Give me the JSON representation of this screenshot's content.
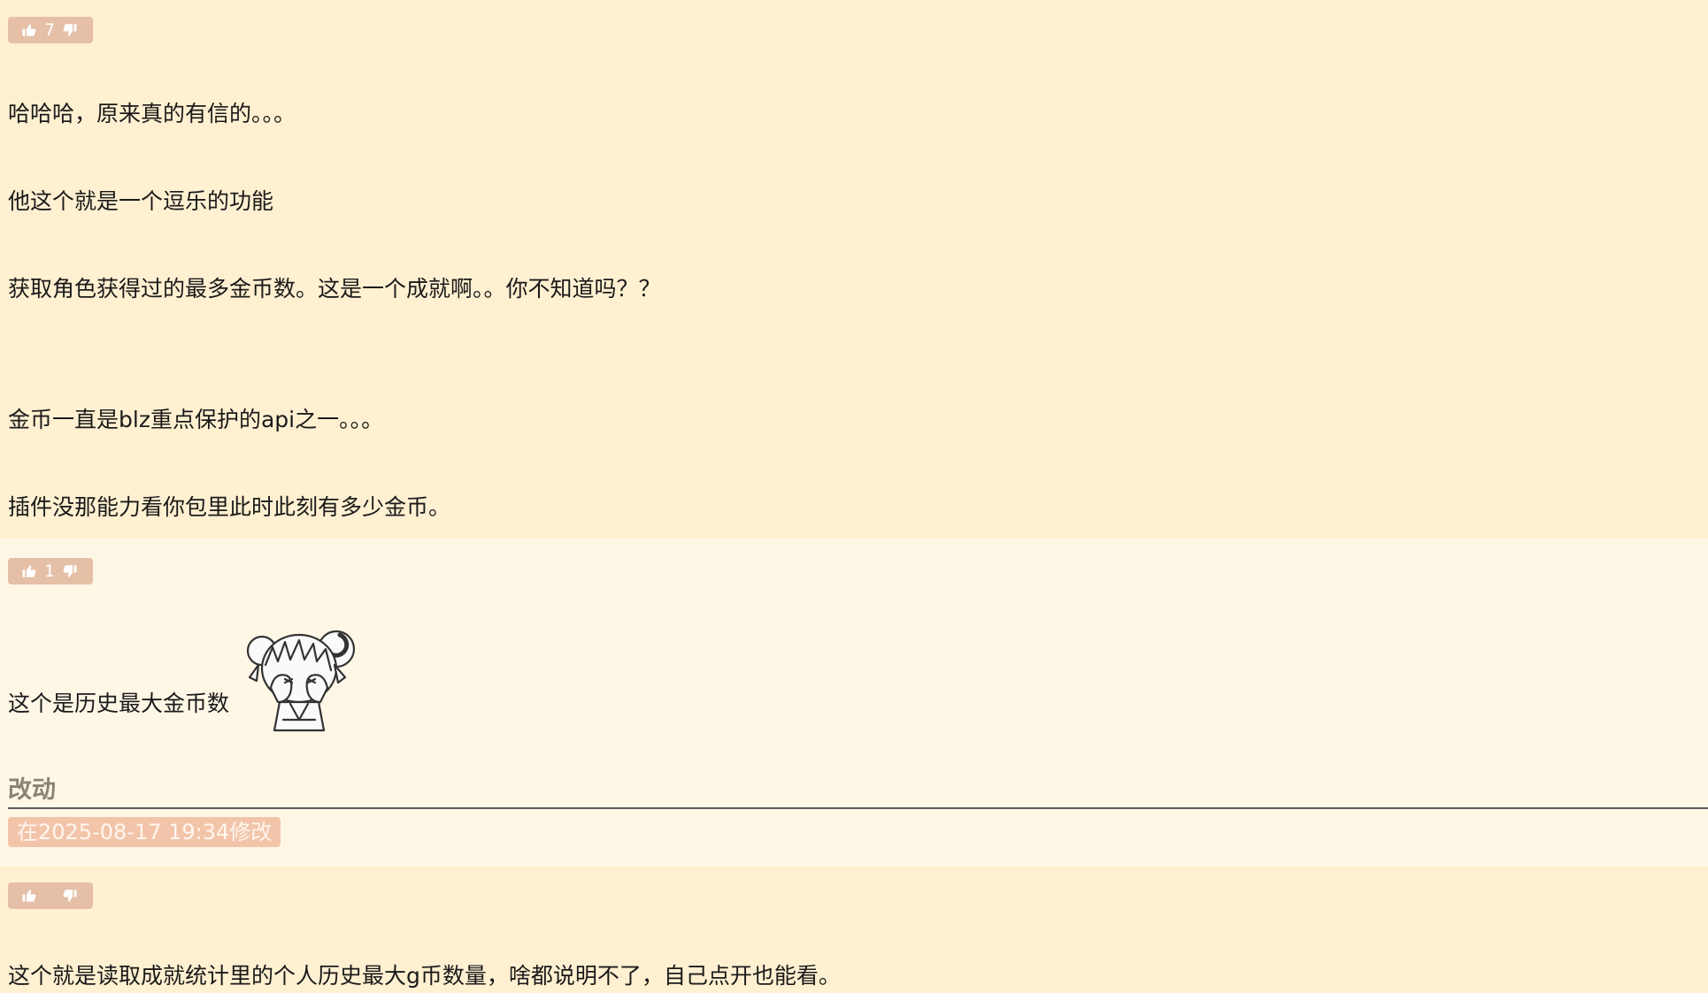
{
  "posts": [
    {
      "votes": {
        "count": "7"
      },
      "lines": [
        "哈哈哈，原来真的有信的。。。",
        "他这个就是一个逗乐的功能",
        "获取角色获得过的最多金币数。这是一个成就啊。。你不知道吗？？",
        "金币一直是blz重点保护的api之一。。。",
        "插件没那能力看你包里此时此刻有多少金币。"
      ]
    },
    {
      "votes": {
        "count": "1"
      },
      "lines": [
        "这个是历史最大金币数"
      ],
      "sticker": "anime-girl-sticker",
      "edit": {
        "label": "改动",
        "badge": "在2025-08-17 19:34修改"
      }
    },
    {
      "votes": {
        "count": ""
      },
      "lines": [
        "这个就是读取成就统计里的个人历史最大g币数量，啥都说明不了，自己点开也能看。"
      ]
    }
  ],
  "icons": {
    "upvote": "thumbs-up-icon",
    "downvote": "thumbs-down-icon"
  },
  "colors": {
    "background_odd": "#fff0d1",
    "background_even": "#fff7e6",
    "vote_bar": "#e5bfa6",
    "edit_badge": "#f2c5aa",
    "edit_label": "#8a8378"
  }
}
